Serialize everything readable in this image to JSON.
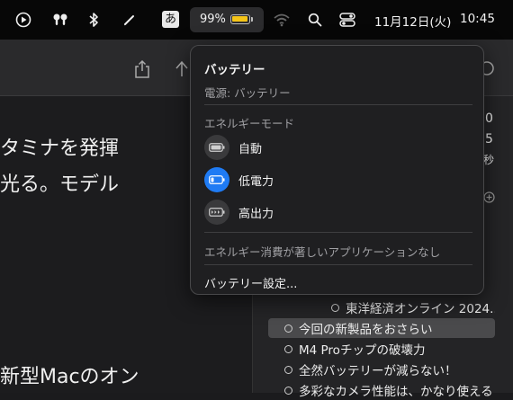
{
  "menubar": {
    "ime_label": "あ",
    "battery_percent": "99%",
    "battery_level": 0.99,
    "battery_fill_color": "#f5c518",
    "date": "11月12日(火)",
    "time": "10:45",
    "icons": [
      "play-circle-icon",
      "airpods-icon",
      "bluetooth-icon",
      "pen-icon",
      "input-method-icon",
      "battery-icon",
      "wifi-icon",
      "search-icon",
      "control-center-icon"
    ]
  },
  "document": {
    "lines": [
      "タミナを発揮",
      "光る。モデル",
      "新型Macのオン"
    ]
  },
  "sidebar": {
    "numbers": [
      "0",
      "5",
      "秒"
    ],
    "items": [
      {
        "label": "東洋経済オンライン 2024...",
        "highlighted": false
      },
      {
        "label": "今回の新製品をおさらい",
        "highlighted": true
      },
      {
        "label": "M4 Proチップの破壊力",
        "highlighted": false
      },
      {
        "label": "全然バッテリーが減らない！",
        "highlighted": false
      },
      {
        "label": "多彩なカメラ性能は、かなり使える",
        "highlighted": false
      }
    ]
  },
  "battery_menu": {
    "title": "バッテリー",
    "power_source": "電源: バッテリー",
    "energy_mode_heading": "エネルギーモード",
    "modes": [
      {
        "label": "自動",
        "icon": "battery-auto-icon",
        "selected": false
      },
      {
        "label": "低電力",
        "icon": "battery-low-power-icon",
        "selected": true
      },
      {
        "label": "高出力",
        "icon": "battery-high-power-icon",
        "selected": false
      }
    ],
    "no_apps_note": "エネルギー消費が著しいアプリケーションなし",
    "settings_label": "バッテリー設定...",
    "accent_color": "#1f7bf4"
  }
}
